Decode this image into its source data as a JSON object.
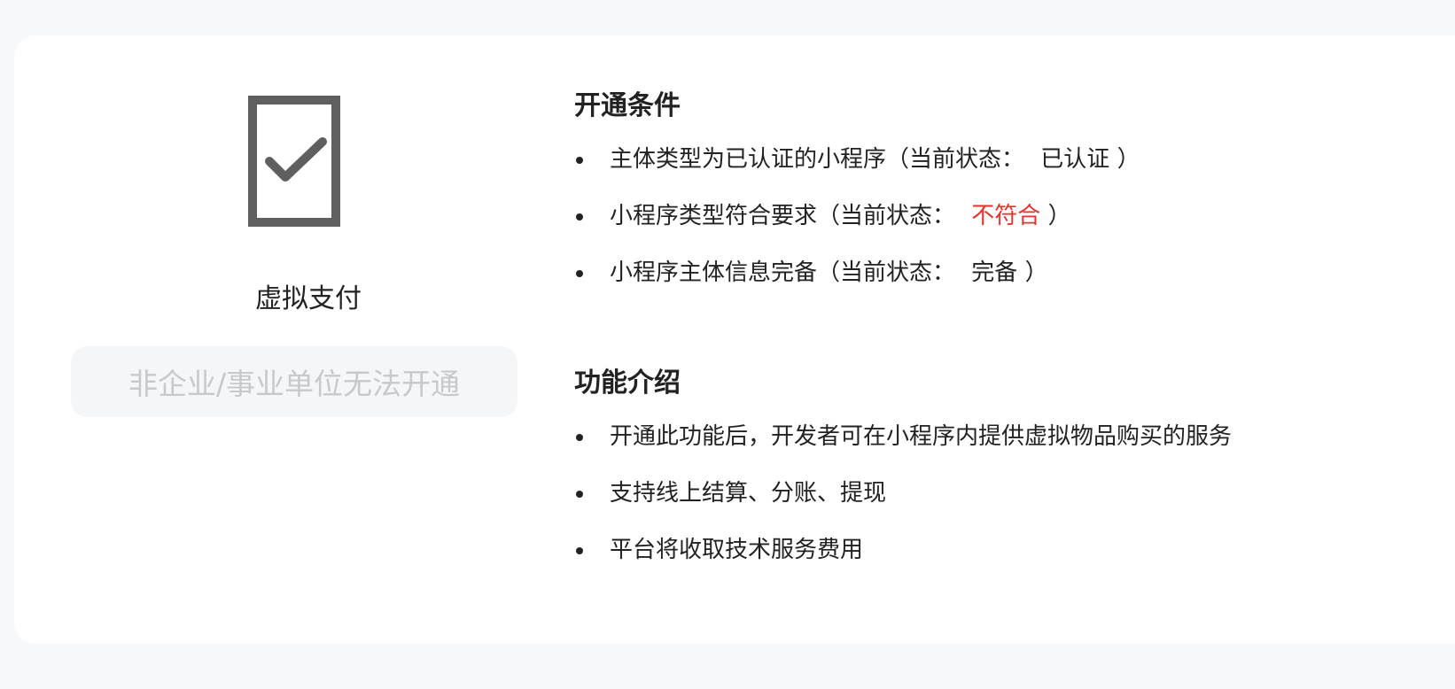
{
  "feature": {
    "icon": "checkbox-document-icon",
    "title": "虚拟支付",
    "button_label": "非企业/事业单位无法开通"
  },
  "conditions": {
    "title": "开通条件",
    "items": [
      {
        "text": "主体类型为已认证的小程序（当前状态：",
        "status": "已认证",
        "suffix": "）",
        "met": true
      },
      {
        "text": "小程序类型符合要求（当前状态：",
        "status": "不符合",
        "suffix": "）",
        "met": false
      },
      {
        "text": "小程序主体信息完备（当前状态：",
        "status": "完备",
        "suffix": "）",
        "met": true
      }
    ]
  },
  "intro": {
    "title": "功能介绍",
    "items": [
      {
        "text": "开通此功能后，开发者可在小程序内提供虚拟物品购买的服务"
      },
      {
        "text": "支持线上结算、分账、提现"
      },
      {
        "text": "平台将收取技术服务费用"
      }
    ]
  },
  "colors": {
    "status_bad": "#e8322c",
    "icon_gray": "#5f5f5f",
    "disabled_text": "#c7c9cd"
  }
}
